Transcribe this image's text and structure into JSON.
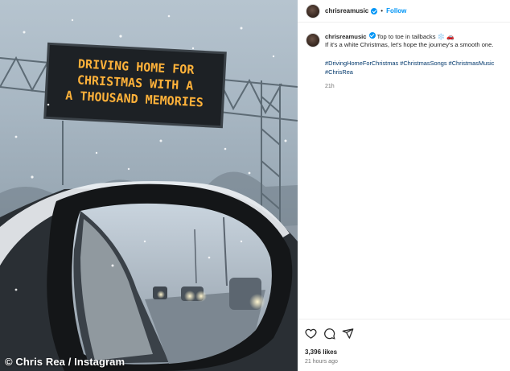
{
  "post": {
    "username": "chrisreamusic",
    "separator": "•",
    "follow_label": "Follow",
    "caption_line1": "Top to toe in tailbacks ❄️ 🚗",
    "caption_line2": "If it's a white Christmas, let's hope the journey's a smooth one.",
    "hashtags": "#DrivingHomeForChristmas #ChristmasSongs #ChristmasMusic #ChrisRea",
    "caption_time": "21h",
    "likes": "3,396 likes",
    "posted_ago": "21 hours ago"
  },
  "photo": {
    "sign_lines": [
      "DRIVING HOME FOR",
      "CHRISTMAS WITH A",
      "A THOUSAND MEMORIES"
    ],
    "credit": "© Chris Rea / Instagram"
  },
  "icons": [
    "heart-icon",
    "comment-icon",
    "share-icon",
    "verified-icon"
  ],
  "colors": {
    "link_blue": "#0095f6",
    "hashtag_blue": "#00376b",
    "sign_amber": "#ffb23a"
  }
}
